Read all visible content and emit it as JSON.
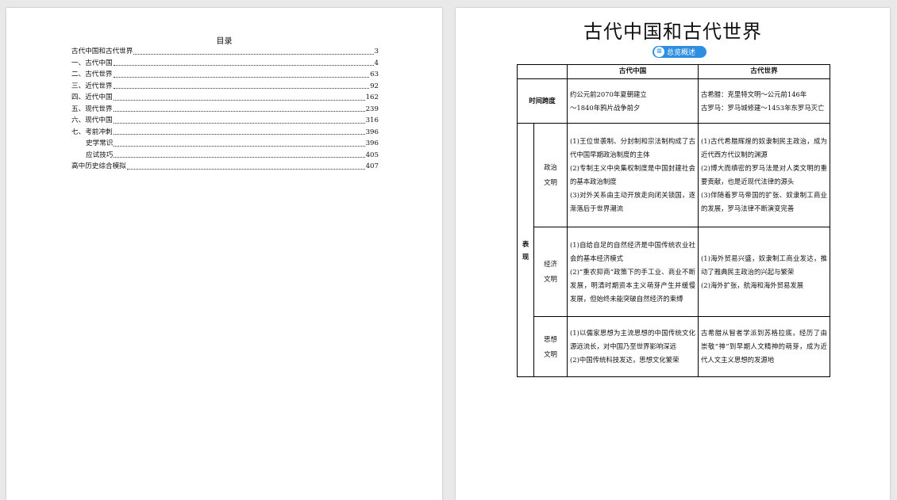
{
  "toc": {
    "title": "目录",
    "entries": [
      {
        "label": "古代中国和古代世界",
        "page": "3",
        "indent": false
      },
      {
        "label": "一、古代中国",
        "page": "4",
        "indent": false
      },
      {
        "label": "二、古代世界",
        "page": "63",
        "indent": false
      },
      {
        "label": "三、近代世界",
        "page": "92",
        "indent": false
      },
      {
        "label": "四、近代中国",
        "page": "162",
        "indent": false
      },
      {
        "label": "五、现代世界",
        "page": "239",
        "indent": false
      },
      {
        "label": "六、现代中国",
        "page": "316",
        "indent": false
      },
      {
        "label": "七、考前冲刺",
        "page": "396",
        "indent": false
      },
      {
        "label": "史学常识",
        "page": "396",
        "indent": true
      },
      {
        "label": "应试技巧",
        "page": "405",
        "indent": true
      },
      {
        "label": "高中历史综合模拟",
        "page": "407",
        "indent": false
      }
    ]
  },
  "doc": {
    "title": "古代中国和古代世界",
    "badge": "总览概述",
    "table": {
      "col_china": "古代中国",
      "col_world": "古代世界",
      "time_label": "时间跨度",
      "time_china": [
        "约公元前2070年夏朝建立",
        "～1840年鸦片战争前夕"
      ],
      "time_world": [
        "古希腊：克里特文明～公元前146年",
        "古罗马：罗马城修建～1453年东罗马灭亡"
      ],
      "group_label": "表现",
      "rows": [
        {
          "label": "政治文明",
          "china": [
            "(1)王位世袭制、分封制和宗法制构成了古代中国早期政治制度的主体",
            "(2)专制主义中央集权制度是中国封建社会的基本政治制度",
            "(3)对外关系由主动开放走向闭关锁国，逐渐落后于世界潮流"
          ],
          "world": [
            "(1)古代希腊辉煌的奴隶制民主政治，成为近代西方代议制的渊源",
            "(2)博大而缜密的罗马法是对人类文明的重要贡献，也是近现代法律的源头",
            "(3)伴随着罗马帝国的扩张、奴隶制工商业的发展，罗马法律不断演变完善"
          ]
        },
        {
          "label": "经济文明",
          "china": [
            "(1)自给自足的自然经济是中国传统农业社会的基本经济模式",
            "(2)“重农抑商”政策下的手工业、商业不断发展，明清时期资本主义萌芽产生并缓慢发展，但始终未能突破自然经济的束缚"
          ],
          "world": [
            "(1)海外贸易兴盛，奴隶制工商业发达，推动了雅典民主政治的兴起与繁荣",
            "(2)海外扩张，航海和海外贸易发展"
          ]
        },
        {
          "label": "思想文明",
          "china": [
            "(1)以儒家思想为主流思想的中国传统文化源远流长，对中国乃至世界影响深远",
            "(2)中国传统科技发达，思想文化繁荣"
          ],
          "world": [
            "古希腊从智者学派到苏格拉底，经历了由崇敬“神”到早期人文精神的萌芽，成为近代人文主义思想的发源地"
          ]
        }
      ]
    }
  }
}
